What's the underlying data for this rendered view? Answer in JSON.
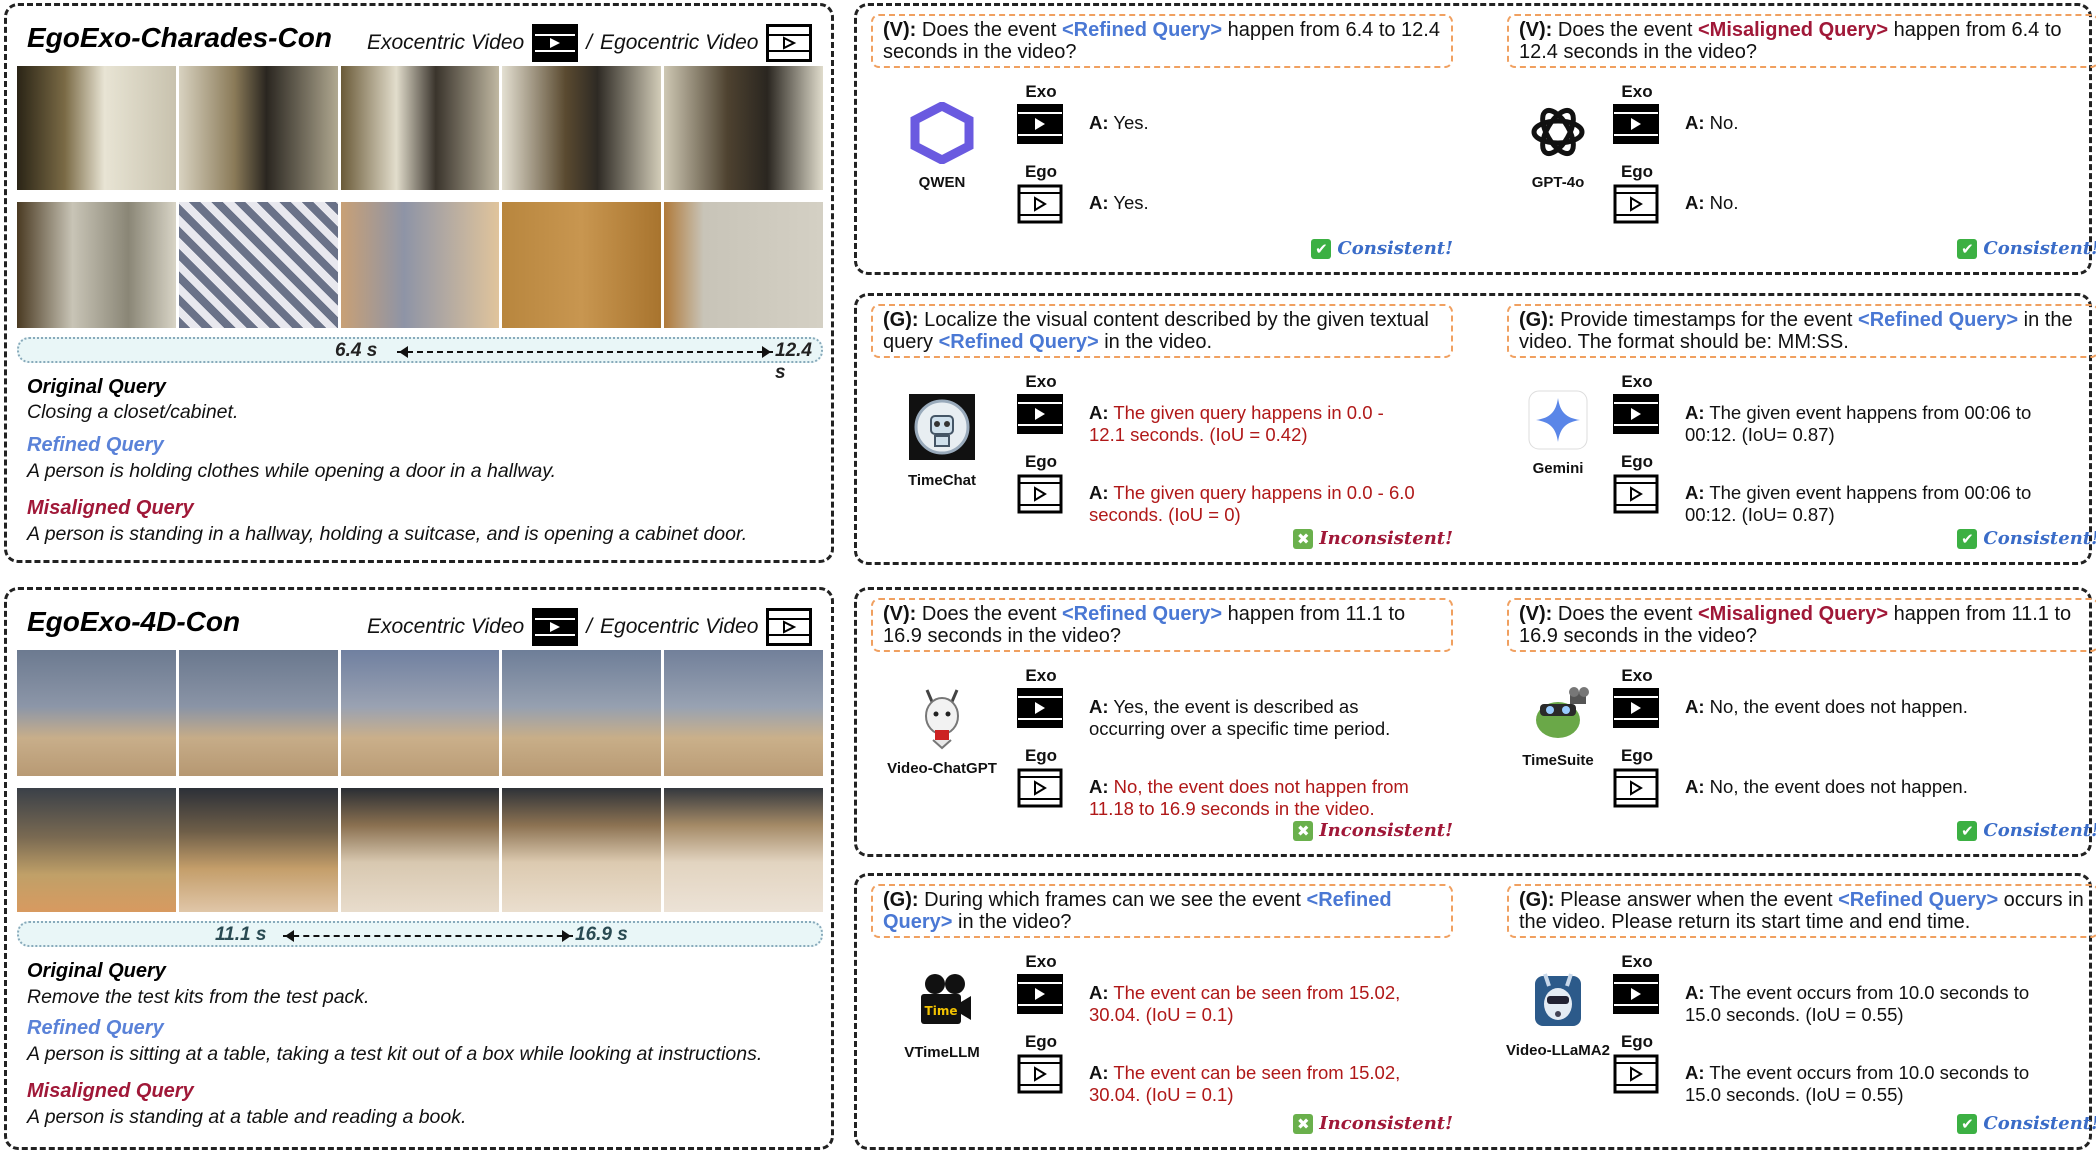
{
  "datasets": [
    {
      "title": "EgoExo-Charades-Con",
      "exo_label": "Exocentric Video",
      "separator": "/",
      "ego_label": "Egocentric Video",
      "time_start": "6.4 s",
      "time_end": "12.4 s",
      "original_heading": "Original Query",
      "original_text": "Closing a closet/cabinet.",
      "refined_heading": "Refined Query",
      "refined_text": "A person is holding clothes while opening a door in a hallway.",
      "misaligned_heading": "Misaligned Query",
      "misaligned_text": "A person is standing in a hallway, holding a suitcase, and is opening a cabinet door."
    },
    {
      "title": "EgoExo-4D-Con",
      "exo_label": "Exocentric Video",
      "separator": "/",
      "ego_label": "Egocentric Video",
      "time_start": "11.1 s",
      "time_end": "16.9 s",
      "original_heading": "Original Query",
      "original_text": "Remove the test kits from the test pack.",
      "refined_heading": "Refined Query",
      "refined_text": "A person is sitting at a table, taking a test kit out of a box while looking at instructions.",
      "misaligned_heading": "Misaligned Query",
      "misaligned_text": "A person is standing at a table and reading a book."
    }
  ],
  "panels": [
    {
      "cells": [
        {
          "q_tag": "(V):",
          "q_pre": "Does the event ",
          "q_tok": "<Refined Query>",
          "q_tok_color": "blue",
          "q_post": " happen from 6.4 to 12.4 seconds in the video?",
          "model": "QWEN",
          "exo": "Exo",
          "ego": "Ego",
          "a_prefix": "A:",
          "exo_answer": "Yes.",
          "exo_error": false,
          "ego_answer": "Yes.",
          "ego_error": false,
          "verdict": "Consistent!",
          "verdict_ok": true
        },
        {
          "q_tag": "(V):",
          "q_pre": "Does the event ",
          "q_tok": "<Misaligned Query>",
          "q_tok_color": "red",
          "q_post": " happen from 6.4 to 12.4 seconds in the video?",
          "model": "GPT-4o",
          "exo": "Exo",
          "ego": "Ego",
          "a_prefix": "A:",
          "exo_answer": "No.",
          "exo_error": false,
          "ego_answer": "No.",
          "ego_error": false,
          "verdict": "Consistent!",
          "verdict_ok": true
        }
      ]
    },
    {
      "cells": [
        {
          "q_tag": "(G):",
          "q_pre": "Localize the visual content described by the given textual query ",
          "q_tok": "<Refined Query>",
          "q_tok_color": "blue",
          "q_post": " in the video.",
          "model": "TimeChat",
          "exo": "Exo",
          "ego": "Ego",
          "a_prefix": "A:",
          "exo_answer": "The given query happens in 0.0 - 12.1 seconds. (IoU = 0.42)",
          "exo_error": true,
          "ego_answer": "The given query happens in 0.0 - 6.0 seconds. (IoU = 0)",
          "ego_error": true,
          "verdict": "Inconsistent!",
          "verdict_ok": false
        },
        {
          "q_tag": "(G):",
          "q_pre": "Provide timestamps for the event ",
          "q_tok": "<Refined Query>",
          "q_tok_color": "blue",
          "q_post": " in the video. The format should be: MM:SS.",
          "model": "Gemini",
          "exo": "Exo",
          "ego": "Ego",
          "a_prefix": "A:",
          "exo_answer": "The given event happens from 00:06 to 00:12. (IoU= 0.87)",
          "exo_error": false,
          "ego_answer": "The given event happens from 00:06 to 00:12. (IoU= 0.87)",
          "ego_error": false,
          "verdict": "Consistent!",
          "verdict_ok": true
        }
      ]
    },
    {
      "cells": [
        {
          "q_tag": "(V):",
          "q_pre": "Does the event ",
          "q_tok": "<Refined Query>",
          "q_tok_color": "blue",
          "q_post": " happen from 11.1 to 16.9 seconds in the video?",
          "model": "Video-ChatGPT",
          "exo": "Exo",
          "ego": "Ego",
          "a_prefix": "A:",
          "exo_answer": "Yes, the event is described as occurring over a specific time period.",
          "exo_error": false,
          "ego_answer": "No, the event does not happen from 11.18 to 16.9 seconds in the video.",
          "ego_error": true,
          "verdict": "Inconsistent!",
          "verdict_ok": false
        },
        {
          "q_tag": "(V):",
          "q_pre": "Does the event ",
          "q_tok": "<Misaligned Query>",
          "q_tok_color": "red",
          "q_post": " happen from 11.1 to 16.9 seconds in the video?",
          "model": "TimeSuite",
          "exo": "Exo",
          "ego": "Ego",
          "a_prefix": "A:",
          "exo_answer": "No, the event does not happen.",
          "exo_error": false,
          "ego_answer": "No, the event does not happen.",
          "ego_error": false,
          "verdict": "Consistent!",
          "verdict_ok": true
        }
      ]
    },
    {
      "cells": [
        {
          "q_tag": "(G):",
          "q_pre": "During which frames can we see the event ",
          "q_tok": "<Refined Query>",
          "q_tok_color": "blue",
          "q_post": " in the video?",
          "model": "VTimeLLM",
          "exo": "Exo",
          "ego": "Ego",
          "a_prefix": "A:",
          "exo_answer": "The event can be seen from 15.02, 30.04. (IoU = 0.1)",
          "exo_error": true,
          "ego_answer": "The event can be seen from 15.02, 30.04. (IoU = 0.1)",
          "ego_error": true,
          "verdict": "Inconsistent!",
          "verdict_ok": false
        },
        {
          "q_tag": "(G):",
          "q_pre": "Please answer when the event ",
          "q_tok": "<Refined Query>",
          "q_tok_color": "blue",
          "q_post": " occurs in the video. Please return its start time and end time.",
          "model": "Video-LLaMA2",
          "exo": "Exo",
          "ego": "Ego",
          "a_prefix": "A:",
          "exo_answer": "The event occurs from 10.0 seconds to 15.0 seconds. (IoU = 0.55)",
          "exo_error": false,
          "ego_answer": "The event occurs from 10.0 seconds to 15.0 seconds. (IoU = 0.55)",
          "ego_error": false,
          "verdict": "Consistent!",
          "verdict_ok": true
        }
      ]
    }
  ],
  "colors": {
    "refined": "#4a78d4",
    "misaligned": "#a01838",
    "error": "#b01818",
    "consistent": "#3a6cc8",
    "inconsistent": "#a01838"
  }
}
